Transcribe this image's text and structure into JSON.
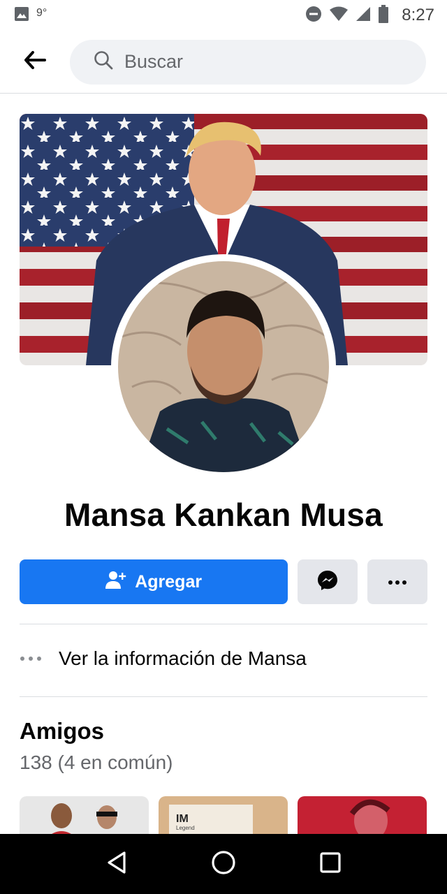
{
  "status_bar": {
    "temperature": "9°",
    "time": "8:27",
    "icons": [
      "image-notification-icon",
      "do-not-disturb-icon",
      "wifi-icon",
      "cell-signal-icon",
      "battery-icon"
    ]
  },
  "header": {
    "back_icon": "arrow-left-icon",
    "search_placeholder": "Buscar"
  },
  "profile": {
    "name": "Mansa Kankan Musa",
    "add_label": "Agregar"
  },
  "info_row": {
    "label": "Ver la información de Mansa"
  },
  "friends": {
    "title": "Amigos",
    "count_text": "138 (4 en común)"
  },
  "nav_bar": {
    "buttons": [
      "back-triangle-icon",
      "home-circle-icon",
      "recents-square-icon"
    ]
  },
  "colors": {
    "accent": "#1877f2",
    "secondary_button": "#e4e6eb",
    "search_bg": "#f0f2f5"
  }
}
